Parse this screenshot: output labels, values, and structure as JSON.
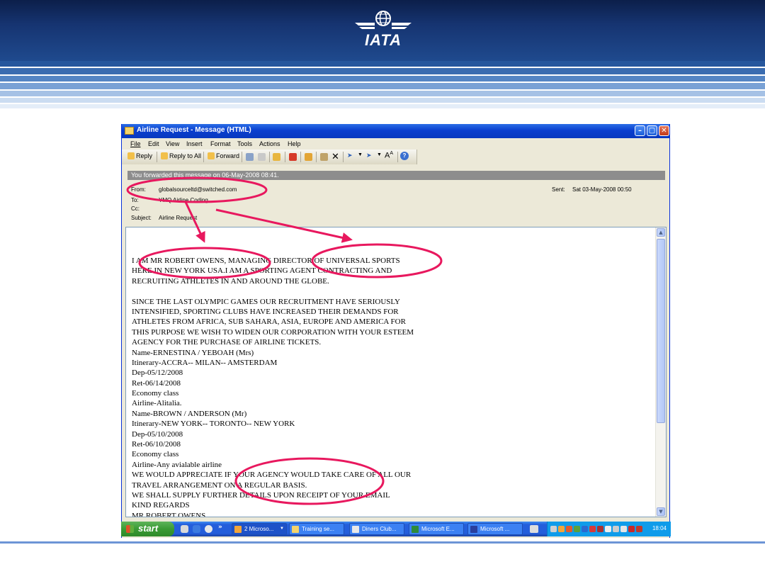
{
  "brand": {
    "logo_text": "IATA",
    "accent": "#1a3d7c",
    "annotation_color": "#e8185e"
  },
  "window": {
    "title": "Airline  Request - Message (HTML)",
    "menu": [
      "File",
      "Edit",
      "View",
      "Insert",
      "Format",
      "Tools",
      "Actions",
      "Help"
    ],
    "toolbar": {
      "reply": "Reply",
      "reply_all": "Reply to All",
      "forward": "Forward"
    },
    "infobar": "You forwarded this message on 06-May-2008 08:41.",
    "header": {
      "from_label": "From:",
      "from_value": "globalsourceltd@switched.com",
      "to_label": "To:",
      "to_value": "YMQ Airline Coding",
      "cc_label": "Cc:",
      "subject_label": "Subject:",
      "subject_value": "Airline  Request",
      "sent_label": "Sent:",
      "sent_value": "Sat 03-May-2008 00:50"
    },
    "body_lines": [
      "I AM MR ROBERT OWENS, MANAGING  DIRECTOR OF UNIVERSAL SPORTS",
      "HERE IN NEW YORK USA.I AM A SPORTING AGENT CONTRACTING AND",
      "RECRUITING ATHLETES IN AND AROUND THE GLOBE.",
      "",
      "SINCE THE LAST OLYMPIC GAMES OUR RECRUITMENT HAVE SERIOUSLY",
      "INTENSIFIED, SPORTING CLUBS HAVE INCREASED THEIR DEMANDS FOR",
      "ATHLETES FROM AFRICA, SUB SAHARA, ASIA, EUROPE AND AMERICA FOR",
      "THIS PURPOSE WE WISH TO WIDEN OUR CORPORATION WITH YOUR ESTEEM",
      "AGENCY FOR THE PURCHASE OF AIRLINE TICKETS.",
      "Name-ERNESTINA / YEBOAH (Mrs)",
      "Itinerary-ACCRA-- MILAN-- AMSTERDAM",
      "Dep-05/12/2008",
      "Ret-06/14/2008",
      "Economy class",
      "Airline-Alitalia.",
      "Name-BROWN / ANDERSON (Mr)",
      "Itinerary-NEW YORK-- TORONTO-- NEW YORK",
      "Dep-05/10/2008",
      "Ret-06/10/2008",
      "Economy class",
      "Airline-Any avialable airline",
      "WE WOULD APPRECIATE IF YOUR AGENCY WOULD TAKE CARE OF ALL OUR",
      "TRAVEL ARRANGEMENT ON A  REGULAR BASIS.",
      "WE SHALL SUPPLY FURTHER DETAILS UPON RECEIPT OF YOUR EMAIL",
      "KIND REGARDS",
      "MR ROBERT OWENS"
    ]
  },
  "taskbar": {
    "start": "start",
    "tasks": [
      "2 Microso...",
      "Training se...",
      "Diners Club...",
      "Microsoft E...",
      "Microsoft ..."
    ],
    "clock": "18:04"
  }
}
